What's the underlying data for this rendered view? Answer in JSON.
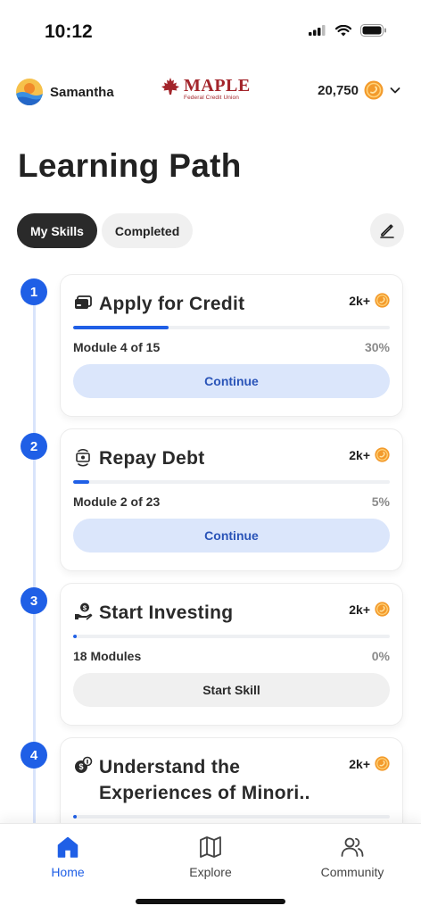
{
  "status_bar": {
    "time": "10:12"
  },
  "header": {
    "user_name": "Samantha",
    "brand_name": "MAPLE",
    "brand_sub": "Federal Credit Union",
    "points": "20,750"
  },
  "page_title": "Learning Path",
  "tabs": [
    {
      "label": "My Skills",
      "active": true
    },
    {
      "label": "Completed",
      "active": false
    }
  ],
  "skills": [
    {
      "step": "1",
      "title": "Apply for Credit",
      "reward": "2k+",
      "meta_left": "Module 4 of 15",
      "meta_right": "30%",
      "progress": 0.3,
      "button": "Continue",
      "icon": "credit-card-icon"
    },
    {
      "step": "2",
      "title": "Repay Debt",
      "reward": "2k+",
      "meta_left": "Module 2 of 23",
      "meta_right": "5%",
      "progress": 0.05,
      "button": "Continue",
      "icon": "cash-cycle-icon"
    },
    {
      "step": "3",
      "title": "Start Investing",
      "reward": "2k+",
      "meta_left": "18 Modules",
      "meta_right": "0%",
      "progress": 0.0,
      "button": "Start Skill",
      "icon": "hand-coin-icon"
    },
    {
      "step": "4",
      "title": "Understand the Experiences of Minori..",
      "reward": "2k+",
      "meta_left": "",
      "meta_right": "",
      "progress": 0.0,
      "button": "",
      "icon": "coin-info-icon"
    }
  ],
  "nav": [
    {
      "label": "Home",
      "icon": "home-icon",
      "active": true
    },
    {
      "label": "Explore",
      "icon": "map-icon",
      "active": false
    },
    {
      "label": "Community",
      "icon": "users-icon",
      "active": false
    }
  ],
  "colors": {
    "accent": "#1f5fe6",
    "brand": "#a3252b",
    "coin": "#f39a2b"
  }
}
